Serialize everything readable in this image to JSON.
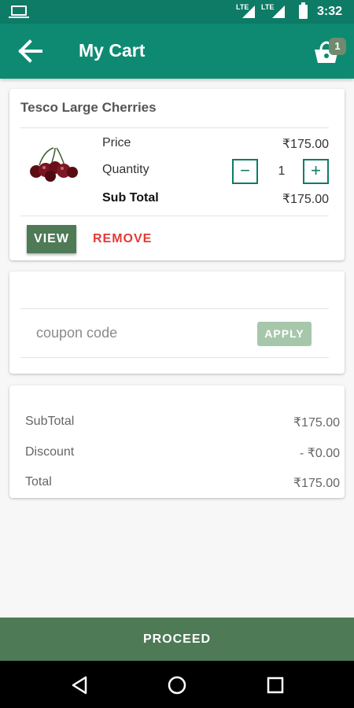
{
  "status_bar": {
    "signal_label_1": "LTE",
    "signal_label_2": "LTE",
    "time": "3:32"
  },
  "app_bar": {
    "title": "My Cart",
    "cart_count": "1",
    "icons": {
      "back": "arrow-left-icon",
      "cart": "shopping-bag-icon"
    }
  },
  "cart_item": {
    "name": "Tesco Large Cherries",
    "image": "cherries-image",
    "price_label": "Price",
    "price": "₹175.00",
    "quantity_label": "Quantity",
    "quantity": "1",
    "minus_symbol": "−",
    "plus_symbol": "+",
    "subtotal_label": "Sub Total",
    "subtotal": "₹175.00",
    "view_label": "VIEW",
    "remove_label": "REMOVE"
  },
  "coupon": {
    "placeholder": "coupon code",
    "value": "",
    "apply_label": "APPLY"
  },
  "summary": {
    "subtotal_label": "SubTotal",
    "subtotal": "₹175.00",
    "discount_label": "Discount",
    "discount": "- ₹0.00",
    "total_label": "Total",
    "total": "₹175.00"
  },
  "proceed_label": "PROCEED",
  "nav": {
    "icons": [
      "back-triangle-icon",
      "home-circle-icon",
      "recents-square-icon"
    ]
  },
  "colors": {
    "status_bar": "#0e7b67",
    "app_bar": "#0e8a73",
    "primary_button": "#4e7a56",
    "remove": "#e53935",
    "apply_disabled": "#a7c7ab"
  }
}
